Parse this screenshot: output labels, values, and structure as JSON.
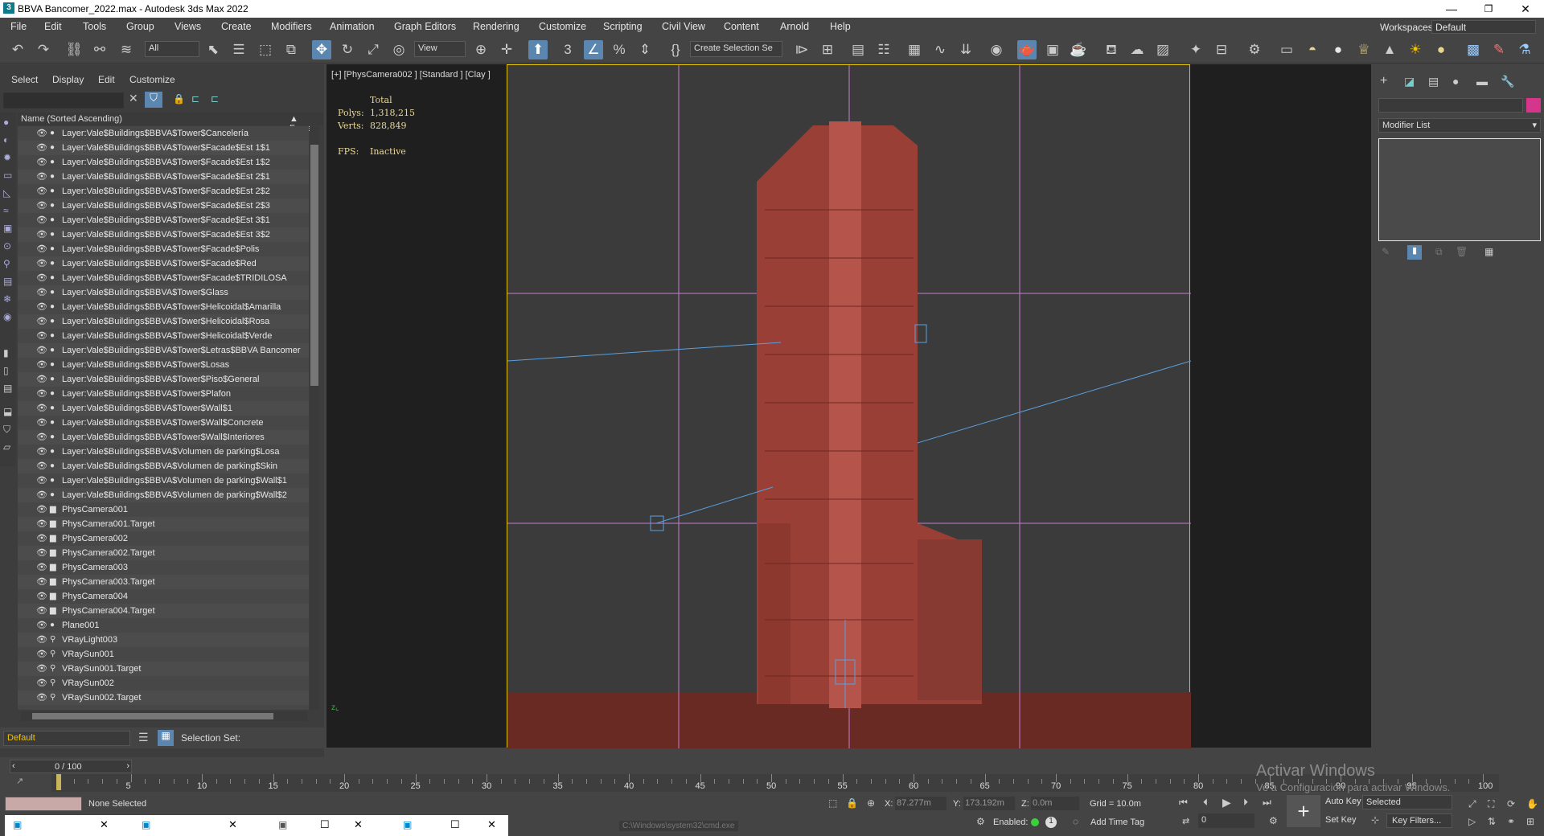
{
  "window": {
    "title": "BBVA Bancomer_2022.max - Autodesk 3ds Max 2022"
  },
  "menu": [
    "File",
    "Edit",
    "Tools",
    "Group",
    "Views",
    "Create",
    "Modifiers",
    "Animation",
    "Graph Editors",
    "Rendering",
    "Customize",
    "Scripting",
    "Civil View",
    "Content",
    "Arnold",
    "Help"
  ],
  "workspace": {
    "label": "Workspaces:",
    "value": "Default"
  },
  "toolbar": {
    "filter": "All",
    "refcoord": "View",
    "selset": "Create Selection Se"
  },
  "scene_tabs": [
    "Select",
    "Display",
    "Edit",
    "Customize"
  ],
  "explorer": {
    "column": "Name (Sorted Ascending)",
    "column2": "▲ Froze",
    "rows": [
      "Layer:Vale$Buildings$BBVA$Tower$Cancelería",
      "Layer:Vale$Buildings$BBVA$Tower$Facade$Est 1$1",
      "Layer:Vale$Buildings$BBVA$Tower$Facade$Est 1$2",
      "Layer:Vale$Buildings$BBVA$Tower$Facade$Est 2$1",
      "Layer:Vale$Buildings$BBVA$Tower$Facade$Est 2$2",
      "Layer:Vale$Buildings$BBVA$Tower$Facade$Est 2$3",
      "Layer:Vale$Buildings$BBVA$Tower$Facade$Est 3$1",
      "Layer:Vale$Buildings$BBVA$Tower$Facade$Est 3$2",
      "Layer:Vale$Buildings$BBVA$Tower$Facade$Polis",
      "Layer:Vale$Buildings$BBVA$Tower$Facade$Red",
      "Layer:Vale$Buildings$BBVA$Tower$Facade$TRIDILOSA",
      "Layer:Vale$Buildings$BBVA$Tower$Glass",
      "Layer:Vale$Buildings$BBVA$Tower$Helicoidal$Amarilla",
      "Layer:Vale$Buildings$BBVA$Tower$Helicoidal$Rosa",
      "Layer:Vale$Buildings$BBVA$Tower$Helicoidal$Verde",
      "Layer:Vale$Buildings$BBVA$Tower$Letras$BBVA Bancomer",
      "Layer:Vale$Buildings$BBVA$Tower$Losas",
      "Layer:Vale$Buildings$BBVA$Tower$Piso$General",
      "Layer:Vale$Buildings$BBVA$Tower$Plafon",
      "Layer:Vale$Buildings$BBVA$Tower$Wall$1",
      "Layer:Vale$Buildings$BBVA$Tower$Wall$Concrete",
      "Layer:Vale$Buildings$BBVA$Tower$Wall$Interiores",
      "Layer:Vale$Buildings$BBVA$Volumen de parking$Losa",
      "Layer:Vale$Buildings$BBVA$Volumen de parking$Skin",
      "Layer:Vale$Buildings$BBVA$Volumen de parking$Wall$1",
      "Layer:Vale$Buildings$BBVA$Volumen de parking$Wall$2",
      "PhysCamera001",
      "PhysCamera001.Target",
      "PhysCamera002",
      "PhysCamera002.Target",
      "PhysCamera003",
      "PhysCamera003.Target",
      "PhysCamera004",
      "PhysCamera004.Target",
      "Plane001",
      "VRayLight003",
      "VRaySun001",
      "VRaySun001.Target",
      "VRaySun002",
      "VRaySun002.Target"
    ]
  },
  "layer": {
    "name": "Default",
    "selset": "Selection Set:"
  },
  "viewport": {
    "label": "[+] [PhysCamera002 ] [Standard ] [Clay ]",
    "total": "Total",
    "polys_label": "Polys:",
    "polys": "1,318,215",
    "verts_label": "Verts:",
    "verts": "828,849",
    "fps_label": "FPS:",
    "fps": "Inactive"
  },
  "modifier": {
    "list": "Modifier List"
  },
  "timeline": {
    "frame": "0 / 100",
    "ticks": [
      "5",
      "10",
      "15",
      "20",
      "25",
      "30",
      "35",
      "40",
      "45",
      "50",
      "55",
      "60",
      "65",
      "70",
      "75",
      "80",
      "85",
      "90",
      "95",
      "100"
    ]
  },
  "status": {
    "none_selected": "None Selected",
    "x": "87.277m",
    "y": "173.192m",
    "z": "0.0m",
    "grid": "Grid = 10.0m",
    "enabled": "Enabled:",
    "add_time_tag": "Add Time Tag",
    "auto_key": "Auto Key",
    "set_key": "Set Key",
    "selected": "Selected",
    "key_filters": "Key Filters...",
    "frame_field": "0",
    "cmd": "C:\\Windows\\system32\\cmd.exe",
    "watermark1": "Activar Windows",
    "watermark2": "Ve a Configuración para activar Windows."
  }
}
